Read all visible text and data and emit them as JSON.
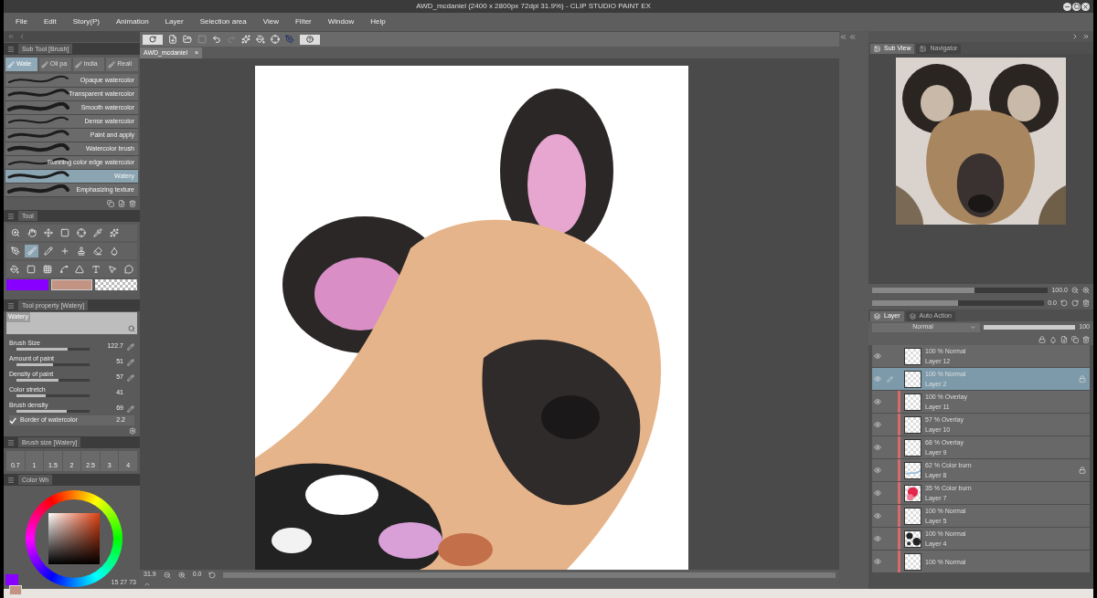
{
  "window": {
    "title": "AWD_mcdaniel (2400 x 2800px 72dpi 31.9%)  - CLIP STUDIO PAINT EX"
  },
  "menu": [
    "File",
    "Edit",
    "Story(P)",
    "Animation",
    "Layer",
    "Selection area",
    "View",
    "Filter",
    "Window",
    "Help"
  ],
  "document_tab": {
    "label": "AWD_mcdaniel",
    "close": "×"
  },
  "sub_tool": {
    "title": "Sub Tool [Brush]",
    "tabs": [
      {
        "label": "Wate",
        "selected": true
      },
      {
        "label": "Oil pa",
        "selected": false
      },
      {
        "label": "India",
        "selected": false
      },
      {
        "label": "Reali",
        "selected": false
      }
    ],
    "items": [
      {
        "label": "Opaque watercolor",
        "selected": false
      },
      {
        "label": "Transparent watercolor",
        "selected": false
      },
      {
        "label": "Smooth watercolor",
        "selected": false
      },
      {
        "label": "Dense watercolor",
        "selected": false
      },
      {
        "label": "Paint and apply",
        "selected": false
      },
      {
        "label": "Watercolor brush",
        "selected": false
      },
      {
        "label": "Running color edge watercolor",
        "selected": false
      },
      {
        "label": "Watery",
        "selected": true
      },
      {
        "label": "Emphasizing texture",
        "selected": false
      }
    ]
  },
  "tool": {
    "title": "Tool",
    "tools": [
      {
        "kind": "zoom",
        "selected": false
      },
      {
        "kind": "hand",
        "selected": false
      },
      {
        "kind": "move",
        "selected": false
      },
      {
        "kind": "select",
        "selected": false
      },
      {
        "kind": "target",
        "selected": false
      },
      {
        "kind": "eyedropper",
        "selected": false
      },
      {
        "kind": "sparkle",
        "selected": false
      },
      {
        "kind": "pen",
        "selected": false
      },
      {
        "kind": "brush",
        "selected": true
      },
      {
        "kind": "pencil",
        "selected": false
      },
      {
        "kind": "plus",
        "selected": false
      },
      {
        "kind": "stamp",
        "selected": false
      },
      {
        "kind": "eraser",
        "selected": false
      },
      {
        "kind": "drop",
        "selected": false
      },
      {
        "kind": "bucket",
        "selected": false
      },
      {
        "kind": "gradient",
        "selected": false
      },
      {
        "kind": "grid",
        "selected": false
      },
      {
        "kind": "curve",
        "selected": false
      },
      {
        "kind": "ruler",
        "selected": false
      },
      {
        "kind": "text",
        "selected": false
      },
      {
        "kind": "pointer",
        "selected": false
      },
      {
        "kind": "balloon",
        "selected": false
      }
    ]
  },
  "tool_property": {
    "title": "Tool property [Watery]",
    "preview_label": "Watery",
    "rows": [
      {
        "label": "Brush Size",
        "value": "122.7",
        "level": 0.7,
        "linked": true
      },
      {
        "label": "Amount of paint",
        "value": "51",
        "level": 0.5,
        "linked": true
      },
      {
        "label": "Density of paint",
        "value": "57",
        "level": 0.57,
        "linked": true
      },
      {
        "label": "Color stretch",
        "value": "41",
        "level": 0.4,
        "linked": false
      },
      {
        "label": "Brush density",
        "value": "69",
        "level": 0.69,
        "linked": true
      }
    ],
    "border": {
      "label": "Border of watercolor",
      "checked": true,
      "value": "2.2"
    }
  },
  "brush_size": {
    "title": "Brush size [Watery]",
    "sizes": [
      "0.7",
      "1",
      "1.5",
      "2",
      "2.5",
      "3",
      "4"
    ]
  },
  "color_wheel": {
    "title": "Color Wh",
    "h": "15",
    "s": "27",
    "v": "73"
  },
  "status": {
    "zoom": "31.9",
    "angle": "0.0"
  },
  "sub_view": {
    "tabs": [
      {
        "label": "Sub View",
        "selected": true
      },
      {
        "label": "Navigator",
        "selected": false
      }
    ]
  },
  "navigator": {
    "zoom": "100.0",
    "zoom_slider": {
      "level": 0.58
    },
    "angle": "0.0",
    "rotation_slider": {
      "level": 0.5
    }
  },
  "layer_panel": {
    "tabs": [
      {
        "label": "Layer",
        "selected": true
      },
      {
        "label": "Auto Action",
        "selected": false
      }
    ],
    "blend": "Normal",
    "opacity": "100",
    "opacity_slider": {
      "level": 1
    },
    "layers": [
      {
        "mode": "100 % Normal",
        "name": "Layer 12",
        "selected": false,
        "clipped": false,
        "kind": "blank",
        "locked": false
      },
      {
        "mode": "100 % Normal",
        "name": "Layer 2",
        "selected": true,
        "clipped": false,
        "kind": "blank",
        "locked": true
      },
      {
        "mode": "100 % Overlay",
        "name": "Layer 11",
        "selected": false,
        "clipped": true,
        "kind": "blank",
        "locked": false
      },
      {
        "mode": "57 % Overlay",
        "name": "Layer 10",
        "selected": false,
        "clipped": true,
        "kind": "blank",
        "locked": false
      },
      {
        "mode": "68 % Overlay",
        "name": "Layer 9",
        "selected": false,
        "clipped": true,
        "kind": "blank",
        "locked": false
      },
      {
        "mode": "62 % Color burn",
        "name": "Layer 8",
        "selected": false,
        "clipped": true,
        "kind": "streak",
        "locked": true
      },
      {
        "mode": "35 % Color burn",
        "name": "Layer 7",
        "selected": false,
        "clipped": true,
        "kind": "blot",
        "locked": false
      },
      {
        "mode": "100 % Normal",
        "name": "Layer 5",
        "selected": false,
        "clipped": true,
        "kind": "blank",
        "locked": false
      },
      {
        "mode": "100 % Normal",
        "name": "Layer 4",
        "selected": false,
        "clipped": true,
        "kind": "spots",
        "locked": false
      },
      {
        "mode": "100 % Normal",
        "selected": false,
        "clipped": true,
        "kind": "blank",
        "locked": false
      }
    ]
  }
}
